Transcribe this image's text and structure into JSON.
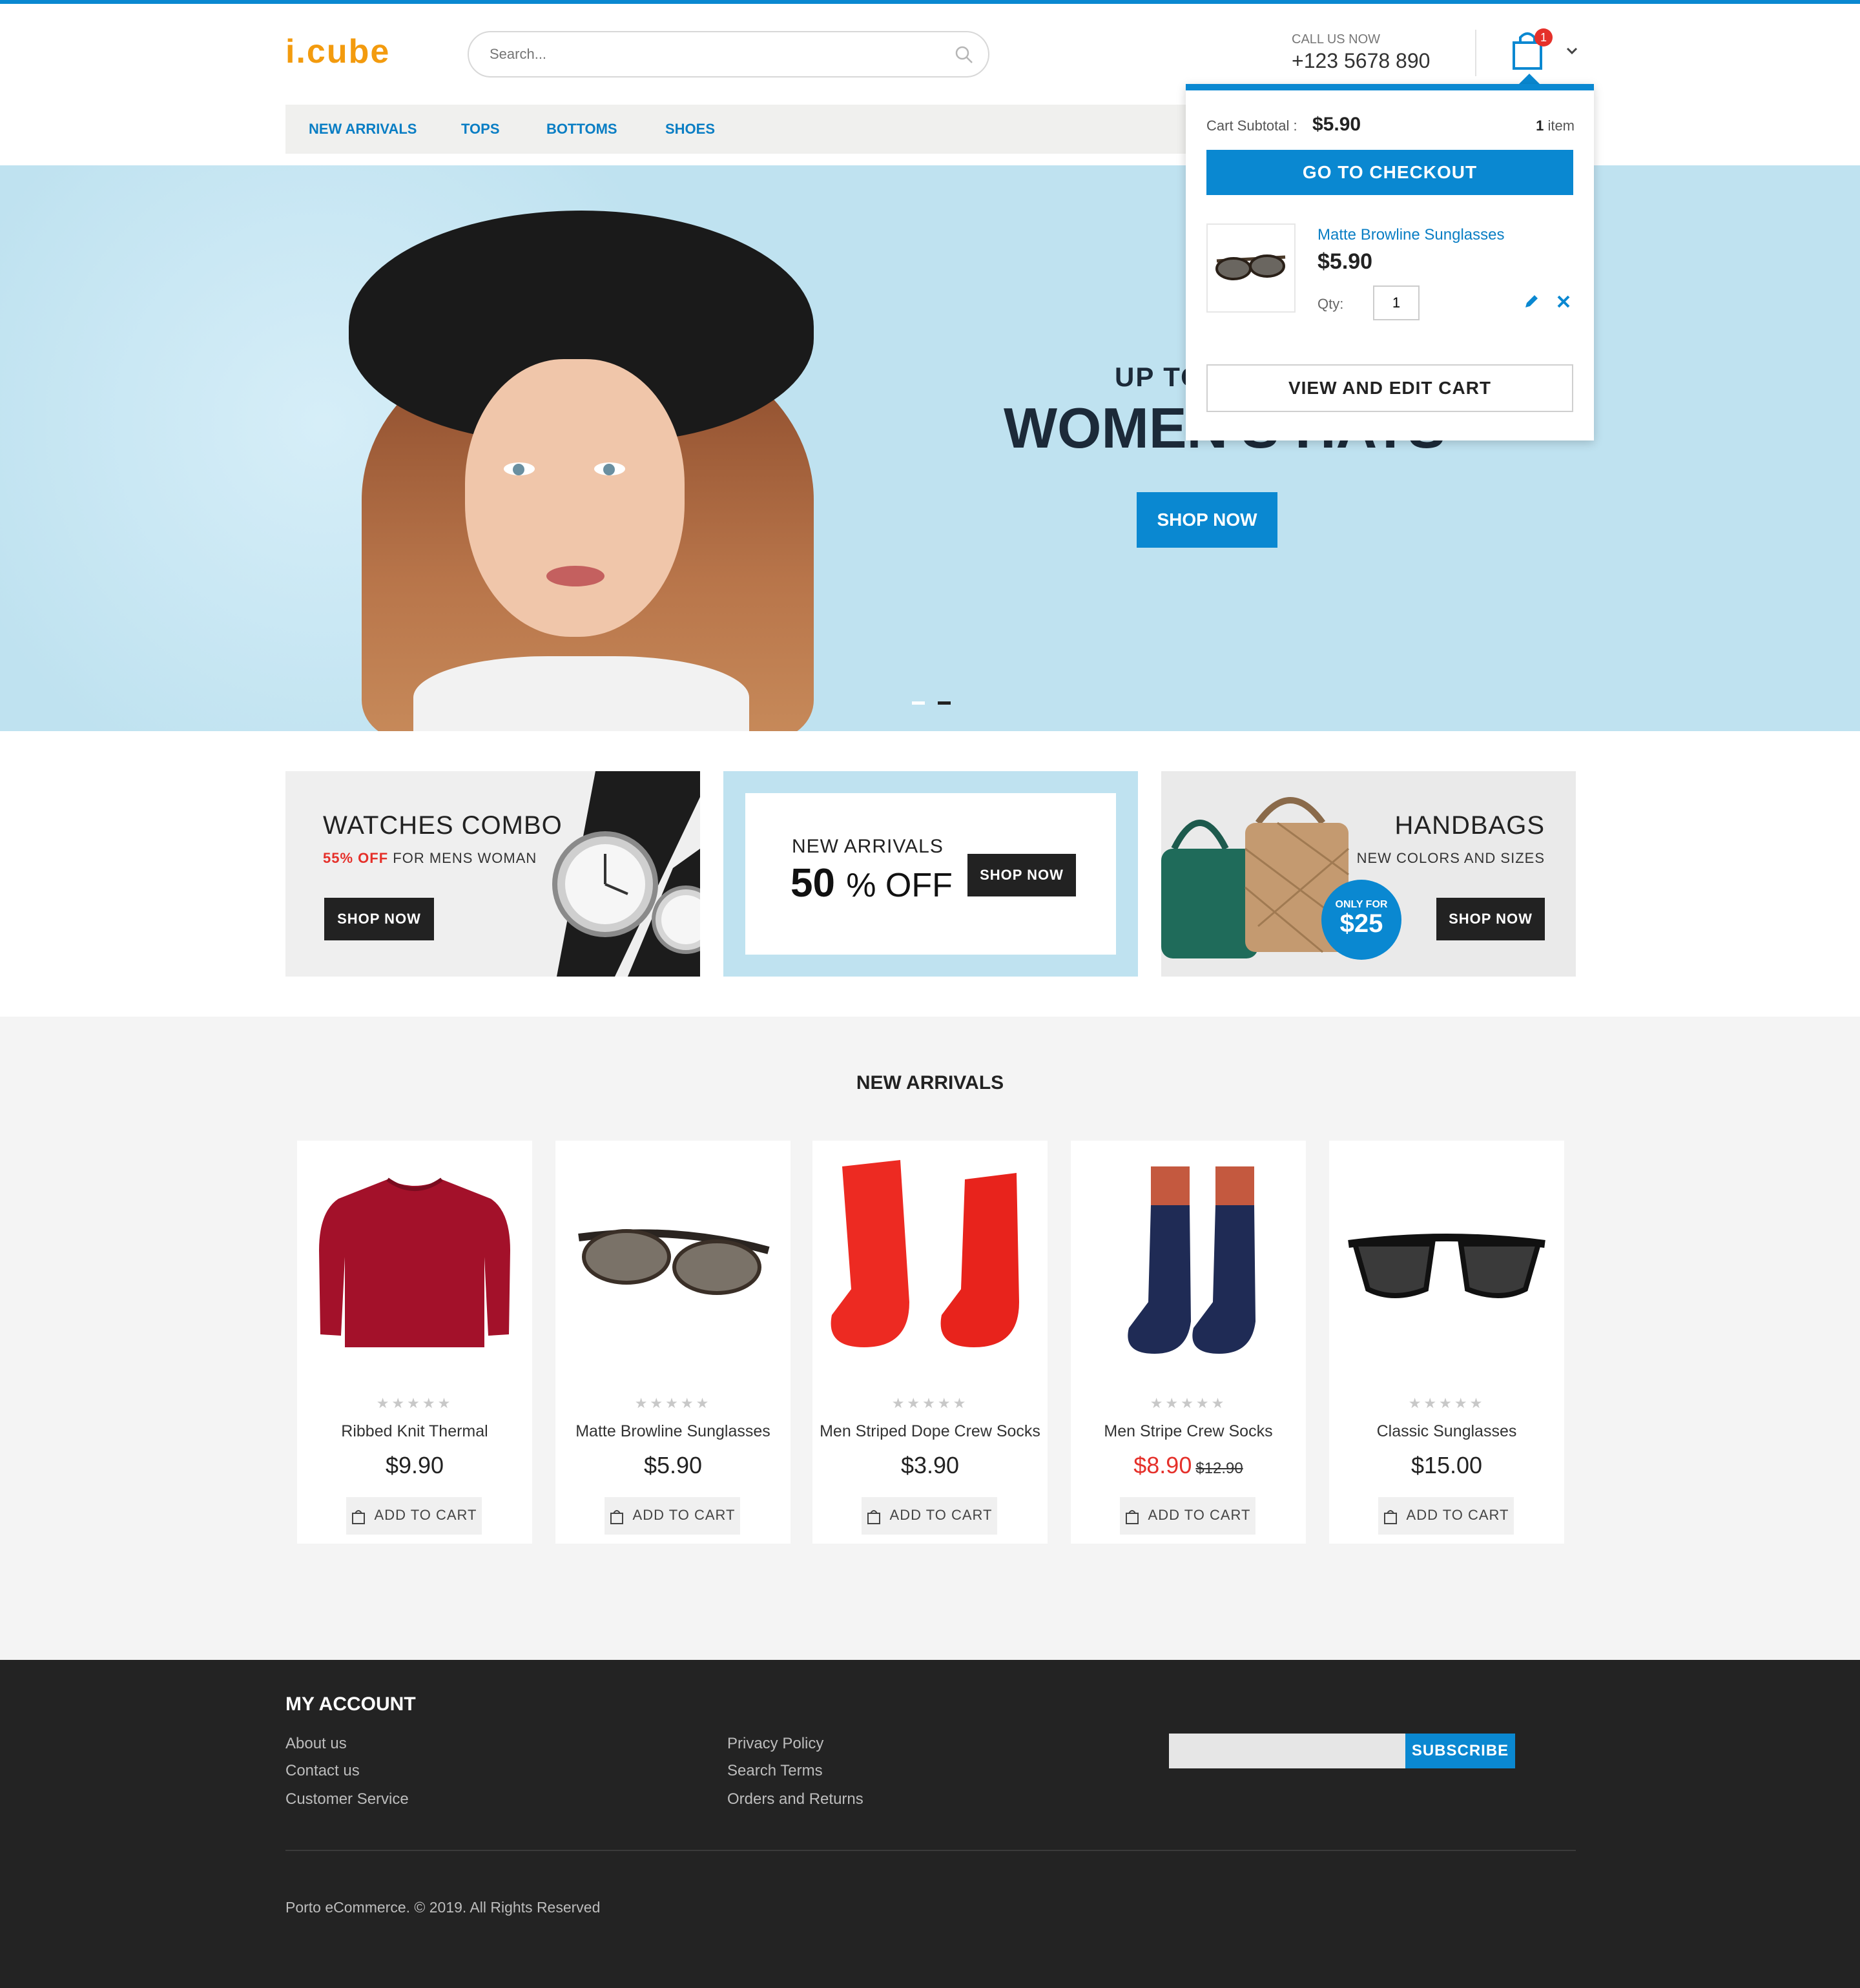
{
  "header": {
    "logo": "i.cube",
    "search_placeholder": "Search...",
    "call_label": "CALL US NOW",
    "phone": "+123 5678 890",
    "cart_count": "1"
  },
  "nav": {
    "items": [
      "NEW ARRIVALS",
      "TOPS",
      "BOTTOMS",
      "SHOES"
    ]
  },
  "hero": {
    "line1": "UP TO",
    "line2": "WOMEN'S HATS",
    "button": "SHOP NOW",
    "slide_current": 2,
    "slide_total": 2
  },
  "cart_dropdown": {
    "subtotal_label": "Cart Subtotal :",
    "subtotal_value": "$5.90",
    "item_count": "1",
    "item_word": "item",
    "checkout": "GO TO CHECKOUT",
    "item_name": "Matte Browline Sunglasses",
    "item_price": "$5.90",
    "qty_label": "Qty:",
    "qty_value": "1",
    "view_edit": "VIEW AND EDIT CART"
  },
  "banners": {
    "b1": {
      "title": "WATCHES COMBO",
      "highlight": "55% OFF",
      "sub": "FOR MENS WOMAN",
      "button": "SHOP NOW"
    },
    "b2": {
      "title": "NEW ARRIVALS",
      "big": "50",
      "off": "% OFF",
      "button": "SHOP NOW"
    },
    "b3": {
      "title": "HANDBAGS",
      "sub": "NEW COLORS AND SIZES",
      "badge_top": "ONLY FOR",
      "badge_price": "$25",
      "button": "SHOP NOW"
    }
  },
  "new_arrivals": {
    "title": "NEW ARRIVALS",
    "add_to_cart": "ADD TO CART",
    "rating_glyphs": "★★★★★",
    "products": [
      {
        "name": "Ribbed Knit Thermal",
        "price": "$9.90",
        "old_price": "",
        "rating": 0
      },
      {
        "name": "Matte Browline Sunglasses",
        "price": "$5.90",
        "old_price": "",
        "rating": 0
      },
      {
        "name": "Men Striped Dope Crew Socks",
        "price": "$3.90",
        "old_price": "",
        "rating": 0
      },
      {
        "name": "Men Stripe Crew Socks",
        "price": "$8.90",
        "old_price": "$12.90",
        "rating": 0
      },
      {
        "name": "Classic Sunglasses",
        "price": "$15.00",
        "old_price": "",
        "rating": 0
      }
    ]
  },
  "footer": {
    "title": "MY ACCOUNT",
    "col1": [
      "About us",
      "Contact us",
      "Customer Service"
    ],
    "col2": [
      "Privacy Policy",
      "Search Terms",
      "Orders and Returns"
    ],
    "subscribe": "SUBSCRIBE",
    "copyright": "Porto eCommerce. © 2019. All Rights Reserved"
  },
  "colors": {
    "accent": "#0a88d1",
    "logo": "#f39b0e",
    "sale": "#e5302a",
    "footer_bg": "#232323"
  },
  "icons": [
    "search-icon",
    "cart-icon",
    "chevron-down-icon",
    "edit-icon",
    "close-icon",
    "bag-icon"
  ]
}
